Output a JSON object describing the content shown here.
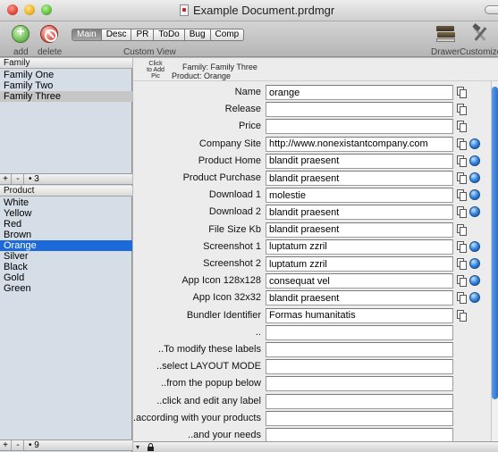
{
  "window": {
    "title": "Example Document.prdmgr"
  },
  "toolbar": {
    "add_label": "add",
    "delete_label": "delete",
    "custom_view_label": "Custom View",
    "drawer_label": "Drawer",
    "customize_label": "Customize",
    "tabs": [
      {
        "label": "Main",
        "active": true
      },
      {
        "label": "Desc",
        "active": false
      },
      {
        "label": "PR",
        "active": false
      },
      {
        "label": "ToDo",
        "active": false
      },
      {
        "label": "Bug",
        "active": false
      },
      {
        "label": "Comp",
        "active": false
      }
    ]
  },
  "sidebar": {
    "family": {
      "header": "Family",
      "items": [
        "Family One",
        "Family Two",
        "Family Three"
      ],
      "selected": "Family Three",
      "count": "3"
    },
    "product": {
      "header": "Product",
      "items": [
        "White",
        "Yellow",
        "Red",
        "Brown",
        "Orange",
        "Silver",
        "Black",
        "Gold",
        "Green"
      ],
      "selected": "Orange",
      "count": "9"
    },
    "plus": "+",
    "minus": "-",
    "dot": "•"
  },
  "header": {
    "pic_hint": "Click to Add Pic",
    "family_line": "Family: Family Three",
    "product_line": "Product: Orange"
  },
  "fields": [
    {
      "label": "Name",
      "value": "orange",
      "copy": true,
      "globe": false
    },
    {
      "label": "Release",
      "value": "",
      "copy": true,
      "globe": false
    },
    {
      "label": "Price",
      "value": "",
      "copy": true,
      "globe": false
    },
    {
      "label": "Company Site",
      "value": "http://www.nonexistantcompany.com",
      "copy": true,
      "globe": true
    },
    {
      "label": "Product Home",
      "value": "blandit praesent",
      "copy": true,
      "globe": true
    },
    {
      "label": "Product Purchase",
      "value": "blandit praesent",
      "copy": true,
      "globe": true
    },
    {
      "label": "Download 1",
      "value": "molestie",
      "copy": true,
      "globe": true
    },
    {
      "label": "Download 2",
      "value": "blandit praesent",
      "copy": true,
      "globe": true
    },
    {
      "label": "File Size Kb",
      "value": "blandit praesent",
      "copy": true,
      "globe": false
    },
    {
      "label": "Screenshot 1",
      "value": "luptatum zzril",
      "copy": true,
      "globe": true
    },
    {
      "label": "Screenshot 2",
      "value": "luptatum zzril",
      "copy": true,
      "globe": true
    },
    {
      "label": "App Icon 128x128",
      "value": "consequat vel",
      "copy": true,
      "globe": true
    },
    {
      "label": "App Icon 32x32",
      "value": "blandit praesent",
      "copy": true,
      "globe": true
    },
    {
      "label": "Bundler Identifier",
      "value": "Formas humanitatis",
      "copy": true,
      "globe": false
    },
    {
      "label": "..",
      "value": "",
      "copy": false,
      "globe": false
    },
    {
      "label": "..To modify these labels",
      "value": "",
      "copy": false,
      "globe": false
    },
    {
      "label": "..select LAYOUT MODE",
      "value": "",
      "copy": false,
      "globe": false
    },
    {
      "label": "..from the popup below",
      "value": "",
      "copy": false,
      "globe": false
    },
    {
      "label": "..click and edit any label",
      "value": "",
      "copy": false,
      "globe": false
    },
    {
      "label": "..according with your products",
      "value": "",
      "copy": false,
      "globe": false
    },
    {
      "label": "..and your needs",
      "value": "",
      "copy": false,
      "globe": false
    }
  ],
  "bottom": {
    "layout_popup": "▾"
  },
  "icons": {
    "add": "add-icon",
    "delete": "delete-icon",
    "drawer": "drawer-icon",
    "customize": "customize-icon",
    "copy": "copy-icon",
    "globe": "globe-icon",
    "lock": "lock-icon"
  }
}
